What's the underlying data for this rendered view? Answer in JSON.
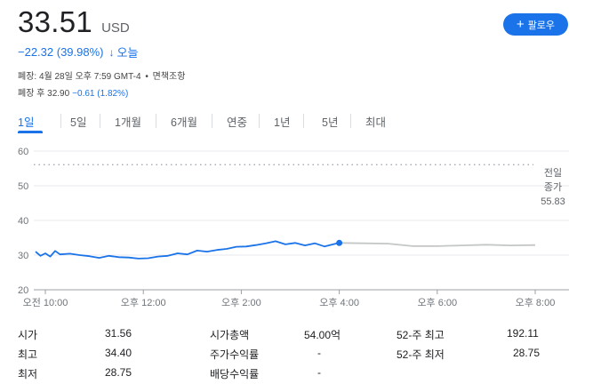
{
  "quote": {
    "price": "33.51",
    "currency": "USD",
    "change": "−22.32 (39.98%)",
    "change_arrow": "↓",
    "period": "오늘",
    "close_info": "폐장: 4월 28일 오후 7:59 GMT-4",
    "disclaimer": "면책조항",
    "after_hours_label": "폐장 후 32.90",
    "after_hours_change": "−0.61 (1.82%)"
  },
  "follow_button": {
    "icon": "plus-icon",
    "label": "팔로우"
  },
  "tabs": [
    "1일",
    "5일",
    "1개월",
    "6개월",
    "연중",
    "1년",
    "5년",
    "최대"
  ],
  "active_tab": "1일",
  "chart_data": {
    "type": "line",
    "ylim": [
      20,
      60
    ],
    "yticks": [
      "60",
      "50",
      "40",
      "30",
      "20"
    ],
    "xtick_labels": [
      "오전 10:00",
      "오후 12:00",
      "오후 2:00",
      "오후 4:00",
      "오후 6:00",
      "오후 8:00"
    ],
    "xtick_hours": [
      10,
      12,
      14,
      16,
      18,
      20
    ],
    "xlim_hours": [
      9.8,
      20.0
    ],
    "prev_close": {
      "value": 55.83,
      "label_line1": "전일",
      "label_line2": "종가",
      "label_value": "55.83"
    },
    "series": [
      {
        "segment": "regular",
        "color": "#1a73e8",
        "x": [
          9.8,
          9.9,
          10.0,
          10.1,
          10.2,
          10.3,
          10.5,
          10.7,
          10.9,
          11.1,
          11.3,
          11.5,
          11.7,
          11.9,
          12.1,
          12.3,
          12.5,
          12.7,
          12.9,
          13.1,
          13.3,
          13.5,
          13.7,
          13.9,
          14.1,
          14.3,
          14.5,
          14.7,
          14.9,
          15.1,
          15.3,
          15.5,
          15.7,
          15.9,
          16.0
        ],
        "y": [
          31.0,
          29.8,
          30.5,
          29.6,
          31.2,
          30.2,
          30.4,
          30.0,
          29.7,
          29.2,
          29.8,
          29.4,
          29.3,
          29.0,
          29.1,
          29.6,
          29.8,
          30.5,
          30.2,
          31.3,
          31.0,
          31.5,
          31.8,
          32.4,
          32.5,
          32.9,
          33.4,
          34.0,
          33.1,
          33.5,
          32.8,
          33.4,
          32.5,
          33.2,
          33.51
        ]
      },
      {
        "segment": "after_hours",
        "color": "#c4c7c5",
        "x": [
          16.0,
          16.5,
          17.0,
          17.5,
          18.0,
          18.5,
          19.0,
          19.5,
          20.0
        ],
        "y": [
          33.51,
          33.4,
          33.3,
          32.6,
          32.6,
          32.8,
          33.0,
          32.8,
          32.9
        ]
      }
    ],
    "current_point": {
      "x": 16.0,
      "y": 33.51
    }
  },
  "stats": [
    {
      "label": "시가",
      "value": "31.56"
    },
    {
      "label": "최고",
      "value": "34.40"
    },
    {
      "label": "최저",
      "value": "28.75"
    },
    {
      "label": "시가총액",
      "value": "54.00억"
    },
    {
      "label": "주가수익률",
      "value": "-"
    },
    {
      "label": "배당수익률",
      "value": "-"
    },
    {
      "label": "52-주 최고",
      "value": "192.11"
    },
    {
      "label": "52-주 최저",
      "value": "28.75"
    }
  ]
}
